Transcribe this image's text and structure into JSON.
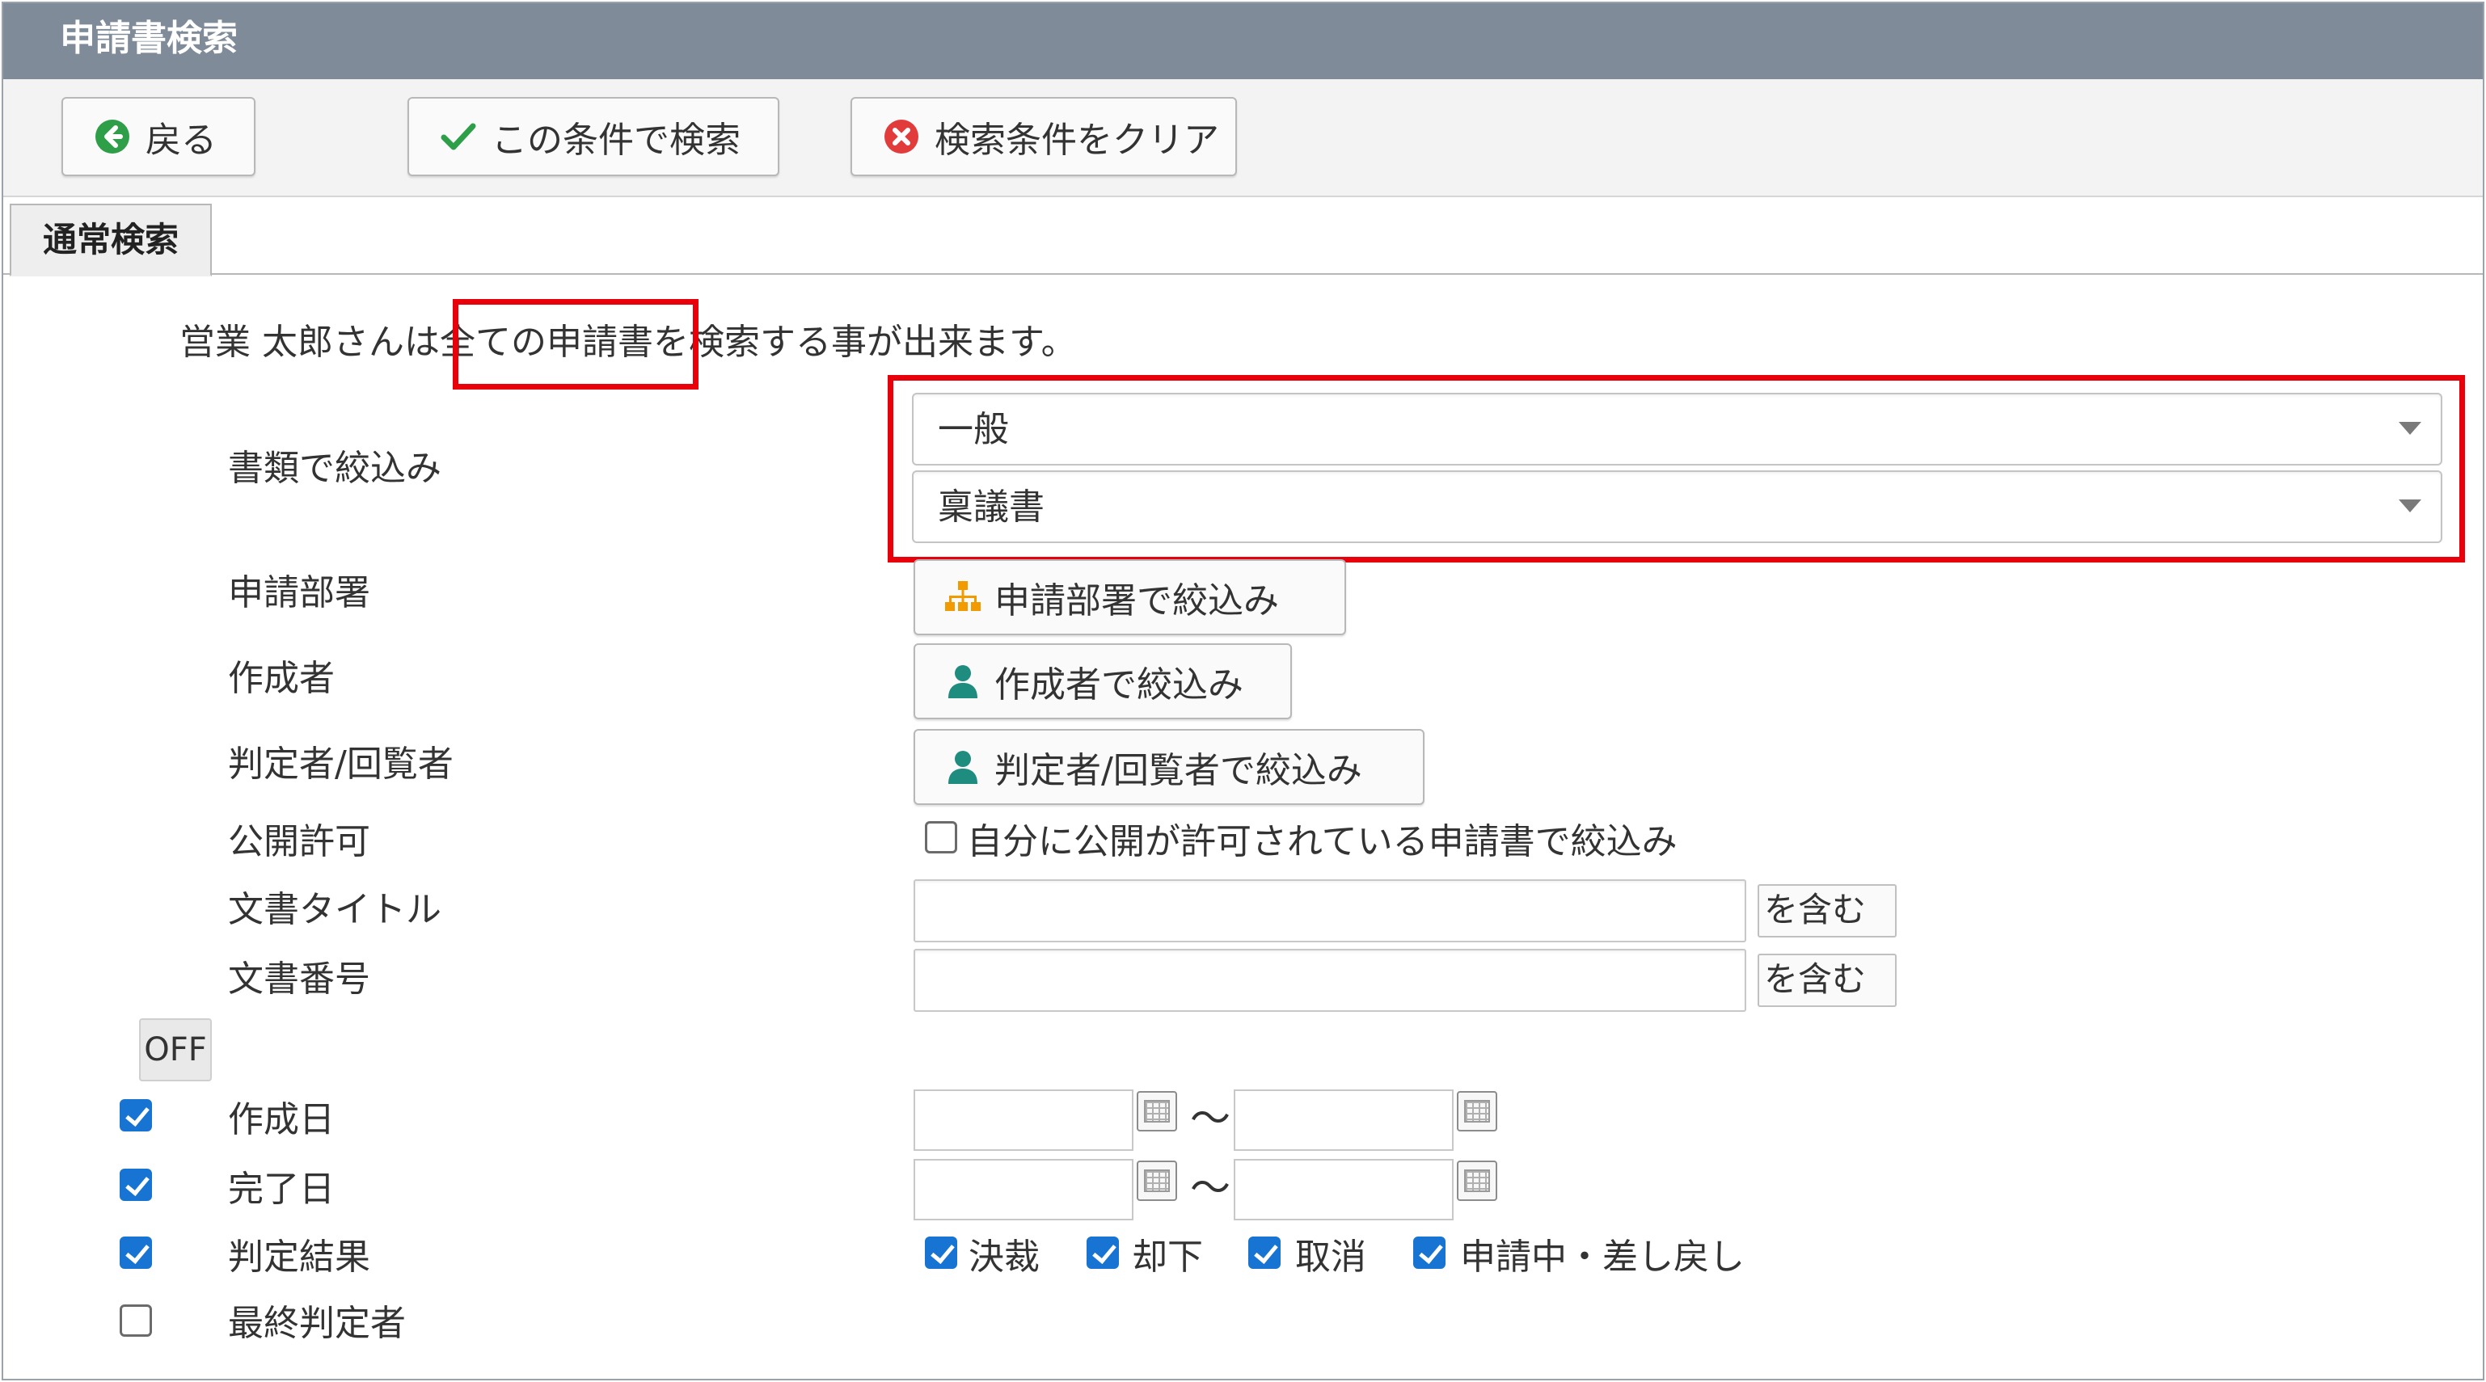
{
  "window": {
    "title": "申請書検索"
  },
  "toolbar": {
    "back_label": "戻る",
    "search_label": "この条件で検索",
    "clear_label": "検索条件をクリア"
  },
  "tabs": [
    {
      "label": "通常検索",
      "active": true
    }
  ],
  "info_text": {
    "prefix": "営業 太郎さんは",
    "highlight": "全ての申請書",
    "suffix": "を検索する事が出来ます。"
  },
  "filters": {
    "doc_type": {
      "label": "書類で絞込み",
      "category_value": "一般",
      "form_value": "稟議書"
    },
    "department": {
      "label": "申請部署",
      "button_label": "申請部署で絞込み"
    },
    "author": {
      "label": "作成者",
      "button_label": "作成者で絞込み"
    },
    "judge": {
      "label": "判定者/回覧者",
      "button_label": "判定者/回覧者で絞込み"
    },
    "public": {
      "label": "公開許可",
      "checkbox_label": "自分に公開が許可されている申請書で絞込み",
      "checked": false
    },
    "doc_title": {
      "label": "文書タイトル",
      "value": "",
      "contains_label": "を含む"
    },
    "doc_number": {
      "label": "文書番号",
      "value": "",
      "contains_label": "を含む"
    }
  },
  "advanced": {
    "toggle_label": "OFF",
    "created_date": {
      "label": "作成日",
      "enabled": true,
      "from": "",
      "to": "",
      "separator": "～"
    },
    "completed_date": {
      "label": "完了日",
      "enabled": true,
      "from": "",
      "to": "",
      "separator": "～"
    },
    "result": {
      "label": "判定結果",
      "enabled": true,
      "options": [
        {
          "label": "決裁",
          "checked": true
        },
        {
          "label": "却下",
          "checked": true
        },
        {
          "label": "取消",
          "checked": true
        },
        {
          "label": "申請中・差し戻し",
          "checked": true
        }
      ]
    },
    "final_judge": {
      "label": "最終判定者",
      "enabled": false
    }
  },
  "colors": {
    "title_bar": "#7f8b98",
    "highlight": "#e8000b",
    "checkbox": "#1874d2",
    "back_icon": "#2e9e48",
    "check_icon": "#2e9e48",
    "clear_icon": "#e23b3b",
    "org_icon": "#f29b00",
    "user_icon": "#1f8c80"
  }
}
